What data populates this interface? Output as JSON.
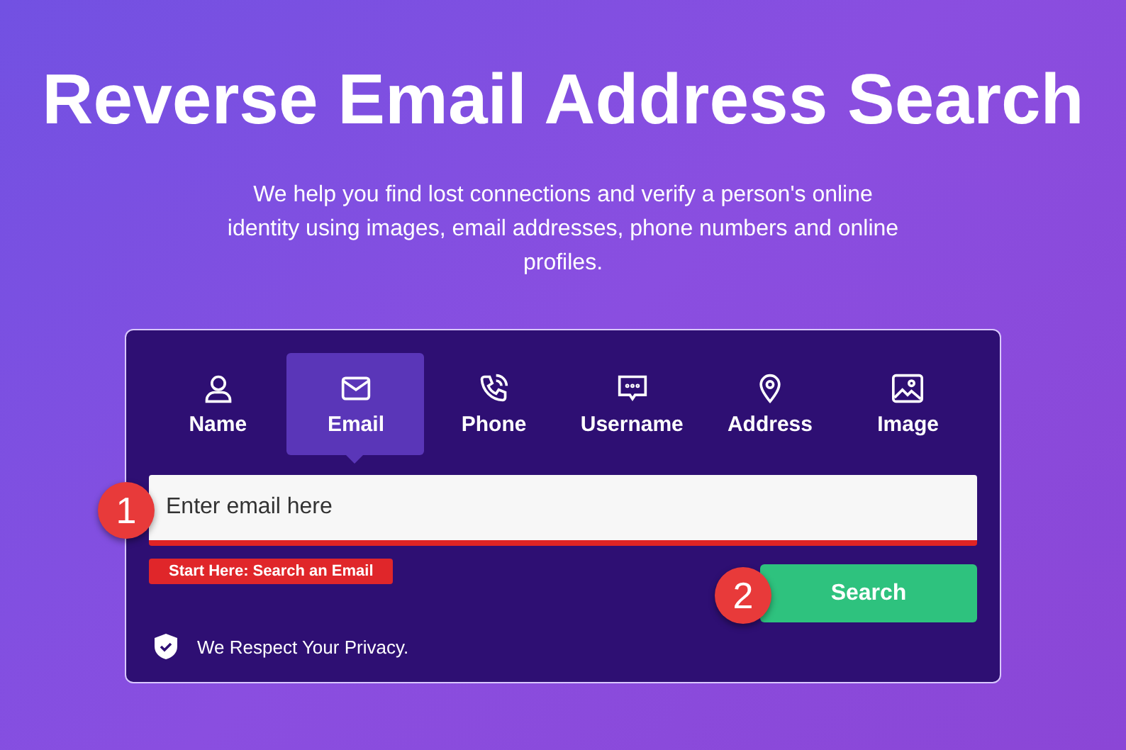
{
  "title": "Reverse Email Address Search",
  "intro": "We help you find lost connections and verify a person's online identity using images, email addresses, phone numbers and online profiles.",
  "tabs": [
    {
      "label": "Name",
      "selected": false
    },
    {
      "label": "Email",
      "selected": true
    },
    {
      "label": "Phone",
      "selected": false
    },
    {
      "label": "Username",
      "selected": false
    },
    {
      "label": "Address",
      "selected": false
    },
    {
      "label": "Image",
      "selected": false
    }
  ],
  "search_field": {
    "placeholder": "Enter email here"
  },
  "hint": "Start Here: Search an Email",
  "search_button": "Search",
  "privacy_note": "We Respect Your Privacy.",
  "step_badges": [
    "1",
    "2"
  ]
}
